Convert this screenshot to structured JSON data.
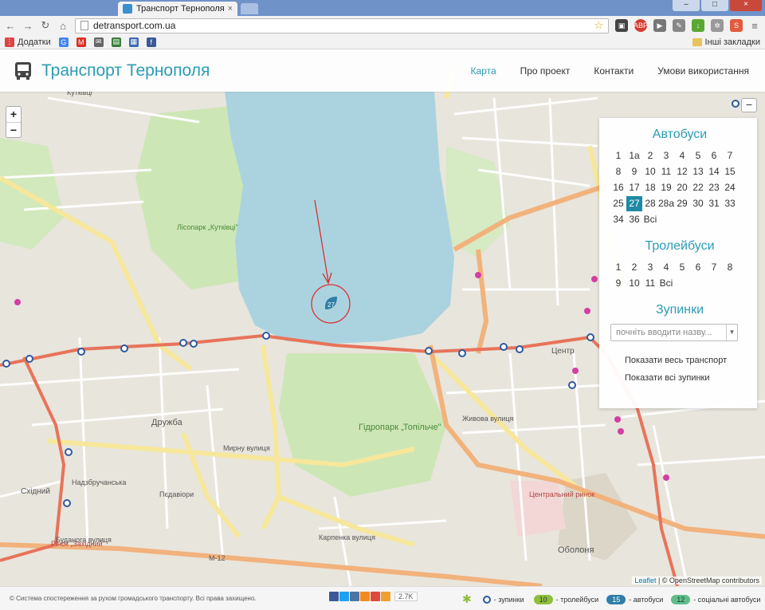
{
  "browser": {
    "tab_title": "Транспорт Тернополя",
    "tab_close": "×",
    "url": "detransport.com.ua",
    "bookmarks": {
      "apps_label": "Додатки",
      "other_label": "Інші закладки"
    }
  },
  "site": {
    "brand": "Транспорт Тернополя",
    "menu": [
      {
        "label": "Карта"
      },
      {
        "label": "Про проект"
      },
      {
        "label": "Контакти"
      },
      {
        "label": "Умови використання"
      }
    ]
  },
  "map": {
    "zoom_in": "+",
    "zoom_out": "−",
    "panel_toggle": "−",
    "vehicle_label": "27",
    "street_labels": [
      "Кутківці",
      "Лісопарк „Кутківці\"",
      "Дружба",
      "Східний",
      "Гідропарк „Топільче\"",
      "Центр",
      "Оболоня",
      "Центральний ринок",
      "Надзбручанська",
      "Пєдавіори",
      "Рінок „Західний\"",
      "Буданога вулиця",
      "Живова вулиця",
      "Мирну вулиця",
      "Карпенка вулиця",
      "М-12"
    ],
    "attribution_leaflet": "Leaflet",
    "attribution_osm": "© OpenStreetMap contributors"
  },
  "panel": {
    "buses_title": "Автобуси",
    "buses": [
      "1",
      "1а",
      "2",
      "3",
      "4",
      "5",
      "6",
      "7",
      "8",
      "9",
      "10",
      "11",
      "12",
      "13",
      "14",
      "15",
      "16",
      "17",
      "18",
      "19",
      "20",
      "22",
      "23",
      "24",
      "25",
      "27",
      "28",
      "28а",
      "29",
      "30",
      "31",
      "33",
      "34",
      "36",
      "Всі"
    ],
    "selected_bus": "27",
    "trolleys_title": "Тролейбуси",
    "trolleys": [
      "1",
      "2",
      "3",
      "4",
      "5",
      "6",
      "7",
      "8",
      "9",
      "10",
      "11",
      "Всі"
    ],
    "stops_title": "Зупинки",
    "stops_placeholder": "почніть вводити назву...",
    "show_all_transport": "Показати весь транспорт",
    "show_all_stops": "Показати всі зупинки"
  },
  "footer": {
    "copyright": "© Система спостереження за рухом громадського транспорту. Всі права захищено.",
    "share_count": "2.7K",
    "legend": [
      {
        "chip": "",
        "label": "- зупинки"
      },
      {
        "chip": "10",
        "label": "- тролейбуси",
        "color": "#8fbf3a"
      },
      {
        "chip": "15",
        "label": "- автобуси",
        "color": "#2f7ea6"
      },
      {
        "chip": "12",
        "label": "- соціальні автобуси",
        "color": "#5dbf8a"
      }
    ]
  },
  "colors": {
    "accent": "#2b9cb4",
    "water": "#aad3df",
    "park": "#cde6b6",
    "road_major": "#f0a37a",
    "route_line": "#e8735a"
  }
}
